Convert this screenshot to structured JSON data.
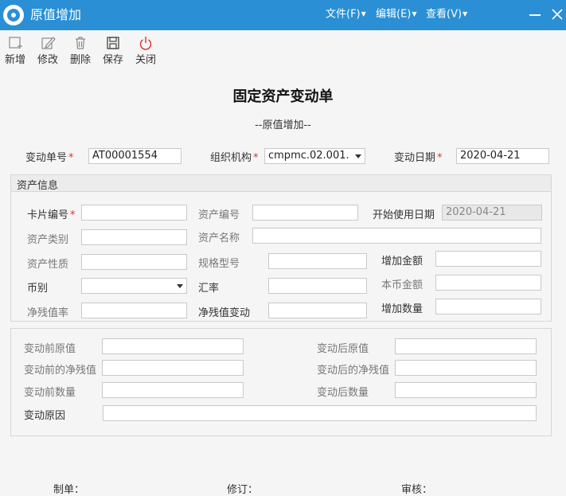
{
  "window": {
    "title": "原值增加"
  },
  "menu": {
    "file": "文件(F)",
    "edit": "编辑(E)",
    "view": "查看(V)"
  },
  "toolbar": {
    "new": "新增",
    "modify": "修改",
    "delete": "删除",
    "save": "保存",
    "close": "关闭"
  },
  "form": {
    "title": "固定资产变动单",
    "subtitle": "--原值增加--"
  },
  "header": {
    "change_no_label": "变动单号",
    "change_no_value": "AT00001554",
    "org_label": "组织机构",
    "org_value": "cmpmc.02.001.",
    "date_label": "变动日期",
    "date_value": "2020-04-21"
  },
  "asset_info": {
    "section_title": "资产信息",
    "card_no_label": "卡片编号",
    "asset_no_label": "资产编号",
    "start_date_label": "开始使用日期",
    "start_date_value": "2020-04-21",
    "asset_type_label": "资产类别",
    "asset_name_label": "资产名称",
    "asset_nature_label": "资产性质",
    "spec_label": "规格型号",
    "increase_amount_label": "增加金额",
    "currency_label": "币别",
    "rate_label": "汇率",
    "local_amount_label": "本币金额",
    "residual_rate_label": "净残值率",
    "residual_change_label": "净残值变动",
    "increase_qty_label": "增加数量"
  },
  "change_info": {
    "before_value_label": "变动前原值",
    "after_value_label": "变动后原值",
    "before_residual_label": "变动前的净残值",
    "after_residual_label": "变动后的净残值",
    "before_qty_label": "变动前数量",
    "after_qty_label": "变动后数量",
    "reason_label": "变动原因"
  },
  "footer": {
    "maker": "制单：",
    "reviser": "修订：",
    "auditor": "审核："
  },
  "colors": {
    "titlebar": "#2a8fd5",
    "required": "#e03030",
    "close_icon": "#e03030"
  }
}
